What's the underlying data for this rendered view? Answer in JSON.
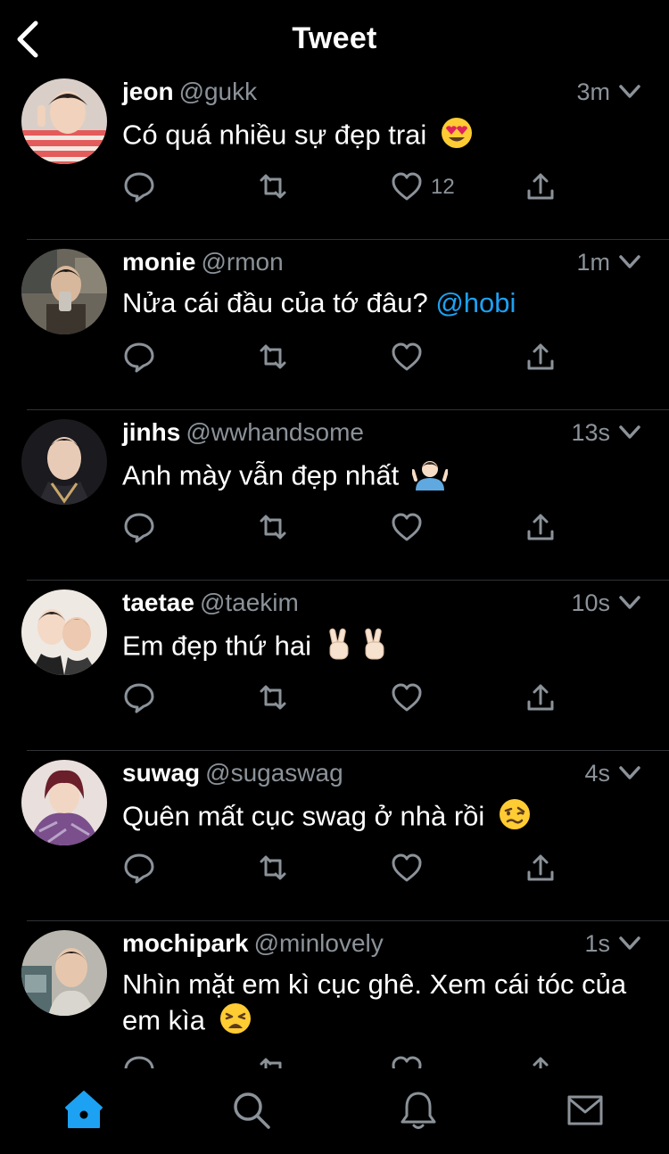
{
  "header": {
    "title": "Tweet"
  },
  "colors": {
    "accent": "#1da1f2",
    "secondary_text": "#8b9299",
    "background": "#000000"
  },
  "tweets": [
    {
      "name": "jeon",
      "handle": "@gukk",
      "time": "3m",
      "text": "Có quá nhiều sự đẹp trai",
      "mention": "",
      "emoji": "heart-eyes-emoji",
      "likes": "12"
    },
    {
      "name": "monie",
      "handle": "@rmon",
      "time": "1m",
      "text": "Nửa cái đầu của tớ đâu?",
      "mention": "@hobi",
      "emoji": "",
      "likes": ""
    },
    {
      "name": "jinhs",
      "handle": "@wwhandsome",
      "time": "13s",
      "text": "Anh mày vẫn đẹp nhất",
      "mention": "",
      "emoji": "shrug-emoji",
      "likes": ""
    },
    {
      "name": "taetae",
      "handle": "@taekim",
      "time": "10s",
      "text": "Em đẹp thứ hai",
      "mention": "",
      "emoji": "victory-hand-emoji",
      "likes": ""
    },
    {
      "name": "suwag",
      "handle": "@sugaswag",
      "time": "4s",
      "text": "Quên mất cục swag ở nhà rồi",
      "mention": "",
      "emoji": "woozy-face-emoji",
      "likes": ""
    },
    {
      "name": "mochipark",
      "handle": "@minlovely",
      "time": "1s",
      "text": "Nhìn mặt em kì cục ghê. Xem cái tóc của em kìa",
      "mention": "",
      "emoji": "weary-face-emoji",
      "likes": ""
    }
  ],
  "tabbar": {
    "items": [
      "home-icon",
      "search-icon",
      "bell-icon",
      "mail-icon"
    ],
    "active": "home-icon"
  }
}
